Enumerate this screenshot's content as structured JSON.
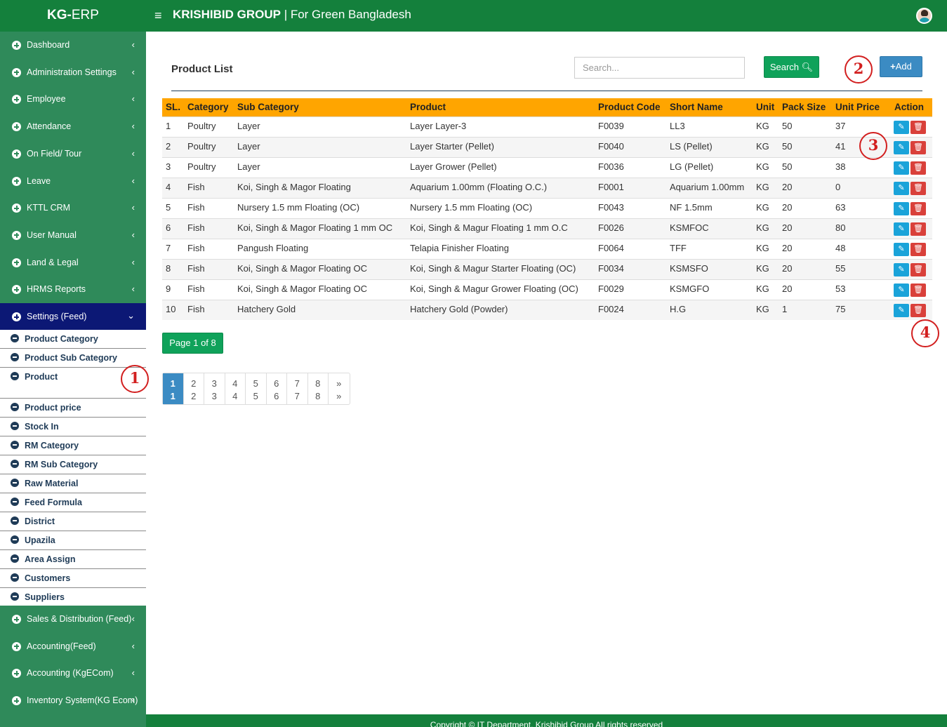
{
  "header": {
    "brand_bold": "KG-",
    "brand_rest": "ERP",
    "menu_icon": "≡",
    "title_bold": "KRISHIBID GROUP",
    "title_rest": " | For Green Bangladesh"
  },
  "sidebar": {
    "items": [
      {
        "label": "Dashboard"
      },
      {
        "label": "Administration Settings"
      },
      {
        "label": "Employee"
      },
      {
        "label": "Attendance"
      },
      {
        "label": "On Field/ Tour"
      },
      {
        "label": "Leave"
      },
      {
        "label": "KTTL CRM"
      },
      {
        "label": "User Manual"
      },
      {
        "label": "Land & Legal"
      },
      {
        "label": "HRMS Reports"
      },
      {
        "label": "Settings (Feed)"
      }
    ],
    "submenu": [
      {
        "label": "Product Category"
      },
      {
        "label": "Product Sub Category"
      },
      {
        "label": "Product"
      },
      {
        "label": "Product price"
      },
      {
        "label": "Stock In"
      },
      {
        "label": "RM Category"
      },
      {
        "label": "RM Sub Category"
      },
      {
        "label": "Raw Material"
      },
      {
        "label": "Feed Formula"
      },
      {
        "label": "District"
      },
      {
        "label": "Upazila"
      },
      {
        "label": "Area Assign"
      },
      {
        "label": "Customers"
      },
      {
        "label": "Suppliers"
      }
    ],
    "items_after": [
      {
        "label": "Sales & Distribution (Feed)"
      },
      {
        "label": "Accounting(Feed)"
      },
      {
        "label": "Accounting (KgECom)"
      },
      {
        "label": "Inventory System(KG Ecom)"
      }
    ]
  },
  "main": {
    "title": "Product List",
    "search_placeholder": "Search...",
    "search_label": "Search",
    "add_label": "Add",
    "table": {
      "headers": [
        "SL.",
        "Category",
        "Sub Category",
        "Product",
        "Product Code",
        "Short Name",
        "Unit",
        "Pack Size",
        "Unit Price",
        "Action"
      ],
      "rows": [
        [
          "1",
          "Poultry",
          "Layer",
          "Layer Layer-3",
          "F0039",
          "LL3",
          "KG",
          "50",
          "37"
        ],
        [
          "2",
          "Poultry",
          "Layer",
          "Layer Starter (Pellet)",
          "F0040",
          "LS (Pellet)",
          "KG",
          "50",
          "41"
        ],
        [
          "3",
          "Poultry",
          "Layer",
          "Layer Grower (Pellet)",
          "F0036",
          "LG (Pellet)",
          "KG",
          "50",
          "38"
        ],
        [
          "4",
          "Fish",
          "Koi, Singh & Magor Floating",
          "Aquarium 1.00mm (Floating O.C.)",
          "F0001",
          "Aquarium 1.00mm",
          "KG",
          "20",
          "0"
        ],
        [
          "5",
          "Fish",
          "Nursery 1.5 mm Floating (OC)",
          "Nursery 1.5 mm Floating (OC)",
          "F0043",
          "NF 1.5mm",
          "KG",
          "20",
          "63"
        ],
        [
          "6",
          "Fish",
          "Koi, Singh & Magor Floating 1 mm OC",
          "Koi, Singh & Magur Floating 1 mm O.C",
          "F0026",
          "KSMFOC",
          "KG",
          "20",
          "80"
        ],
        [
          "7",
          "Fish",
          "Pangush Floating",
          "Telapia Finisher Floating",
          "F0064",
          "TFF",
          "KG",
          "20",
          "48"
        ],
        [
          "8",
          "Fish",
          "Koi, Singh & Magor Floating OC",
          "Koi, Singh & Magur Starter Floating (OC)",
          "F0034",
          "KSMSFO",
          "KG",
          "20",
          "55"
        ],
        [
          "9",
          "Fish",
          "Koi, Singh & Magor Floating OC",
          "Koi, Singh & Magur Grower Floating (OC)",
          "F0029",
          "KSMGFO",
          "KG",
          "20",
          "53"
        ],
        [
          "10",
          "Fish",
          "Hatchery Gold",
          "Hatchery Gold (Powder)",
          "F0024",
          "H.G",
          "KG",
          "1",
          "75"
        ]
      ]
    },
    "page_info": "Page 1 of 8",
    "pagination": [
      "1",
      "2",
      "3",
      "4",
      "5",
      "6",
      "7",
      "8",
      "»"
    ],
    "current_page": "1"
  },
  "annotations": [
    "1",
    "2",
    "3",
    "4"
  ],
  "footer": {
    "text": "Copyright © IT Department, Krishibid Group All rights reserved"
  },
  "colors": {
    "header": "#14803c",
    "sidebar": "#2f8a5a",
    "active_nav": "#0c1875",
    "table_header": "#ffa500",
    "add_button": "#3b8bc3",
    "search_button": "#0fa25a",
    "edit": "#1aa3d9",
    "delete": "#d9403a",
    "marker": "#d21f1f"
  }
}
